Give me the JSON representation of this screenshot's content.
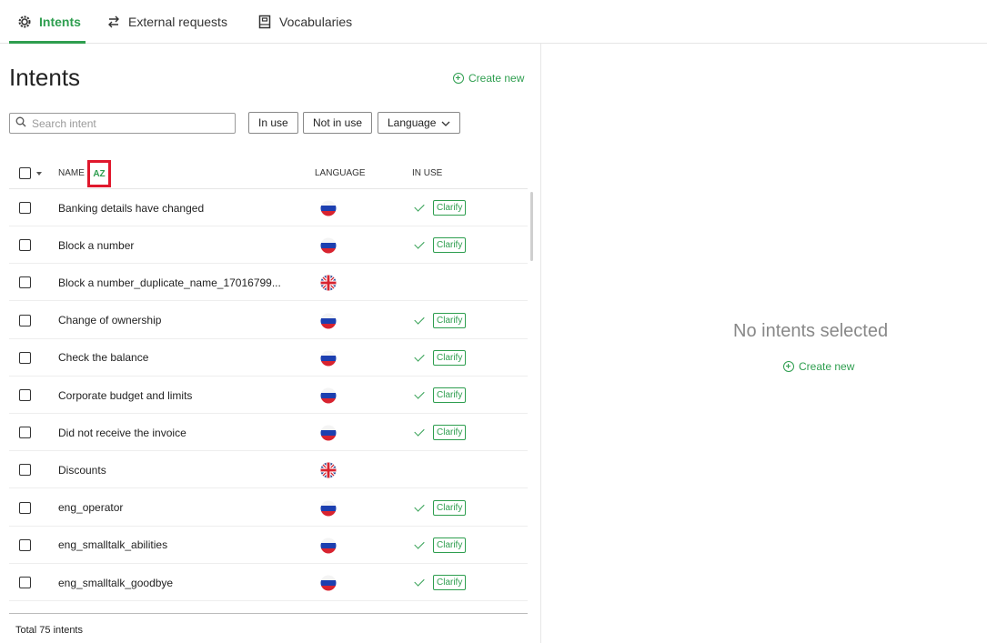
{
  "tabs": [
    {
      "label": "Intents",
      "icon": "gear-icon",
      "active": true
    },
    {
      "label": "External requests",
      "icon": "swap-arrows-icon",
      "active": false
    },
    {
      "label": "Vocabularies",
      "icon": "book-icon",
      "active": false
    }
  ],
  "page": {
    "title": "Intents",
    "create_new": "Create new"
  },
  "search": {
    "placeholder": "Search intent",
    "value": ""
  },
  "filters": {
    "in_use": "In use",
    "not_in_use": "Not in use",
    "language": "Language"
  },
  "table": {
    "columns": {
      "name": "NAME",
      "language": "LANGUAGE",
      "in_use": "IN USE"
    },
    "sort_icon": "AZ",
    "rows": [
      {
        "name": "Banking details have changed",
        "lang": "ru",
        "in_use": true,
        "badge": "Clarify"
      },
      {
        "name": "Block a number",
        "lang": "ru",
        "in_use": true,
        "badge": "Clarify"
      },
      {
        "name": "Block a number_duplicate_name_17016799...",
        "lang": "en",
        "in_use": false,
        "badge": ""
      },
      {
        "name": "Change of ownership",
        "lang": "ru",
        "in_use": true,
        "badge": "Clarify"
      },
      {
        "name": "Check the balance",
        "lang": "ru",
        "in_use": true,
        "badge": "Clarify"
      },
      {
        "name": "Corporate budget and limits",
        "lang": "ru",
        "in_use": true,
        "badge": "Clarify"
      },
      {
        "name": "Did not receive the invoice",
        "lang": "ru",
        "in_use": true,
        "badge": "Clarify"
      },
      {
        "name": "Discounts",
        "lang": "en",
        "in_use": false,
        "badge": ""
      },
      {
        "name": "eng_operator",
        "lang": "ru",
        "in_use": true,
        "badge": "Clarify"
      },
      {
        "name": "eng_smalltalk_abilities",
        "lang": "ru",
        "in_use": true,
        "badge": "Clarify"
      },
      {
        "name": "eng_smalltalk_goodbye",
        "lang": "ru",
        "in_use": true,
        "badge": "Clarify"
      }
    ],
    "total": "Total 75 intents"
  },
  "detail": {
    "empty_title": "No intents selected",
    "create_new": "Create new"
  },
  "colors": {
    "accent": "#2e9e4f",
    "highlight": "#e0182d"
  }
}
